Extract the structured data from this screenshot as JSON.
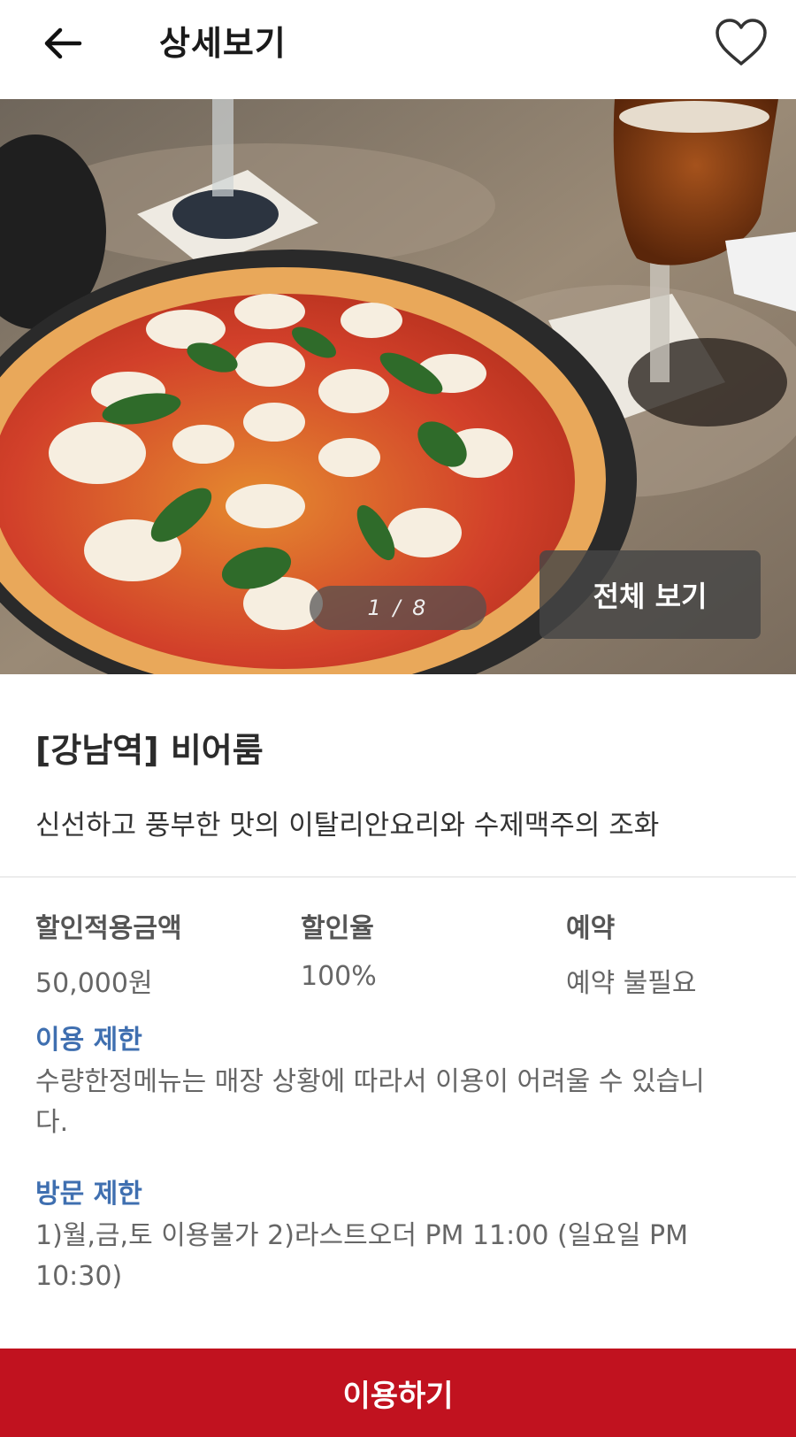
{
  "header": {
    "title": "상세보기",
    "back_icon": "arrow-left-icon",
    "favorite_icon": "heart-outline-icon"
  },
  "gallery": {
    "pager": "1 / 8",
    "view_all_label": "전체 보기"
  },
  "store": {
    "name": "[강남역] 비어룸",
    "description": "신선하고 풍부한 맛의 이탈리안요리와 수제맥주의 조화"
  },
  "stats": [
    {
      "label": "할인적용금액",
      "value": "50,000원"
    },
    {
      "label": "할인율",
      "value": "100%"
    },
    {
      "label": "예약",
      "value": "예약 불필요"
    }
  ],
  "usage_limit": {
    "title": "이용 제한",
    "body": "수량한정메뉴는 매장 상황에 따라서 이용이 어려울 수 있습니다."
  },
  "visit_limit": {
    "title": "방문 제한",
    "body": "1)월,금,토 이용불가 2)라스트오더 PM 11:00 (일요일 PM 10:30)"
  },
  "cta": {
    "label": "이용하기"
  },
  "colors": {
    "accent": "#c1121f",
    "section_title": "#3f6fb0"
  }
}
